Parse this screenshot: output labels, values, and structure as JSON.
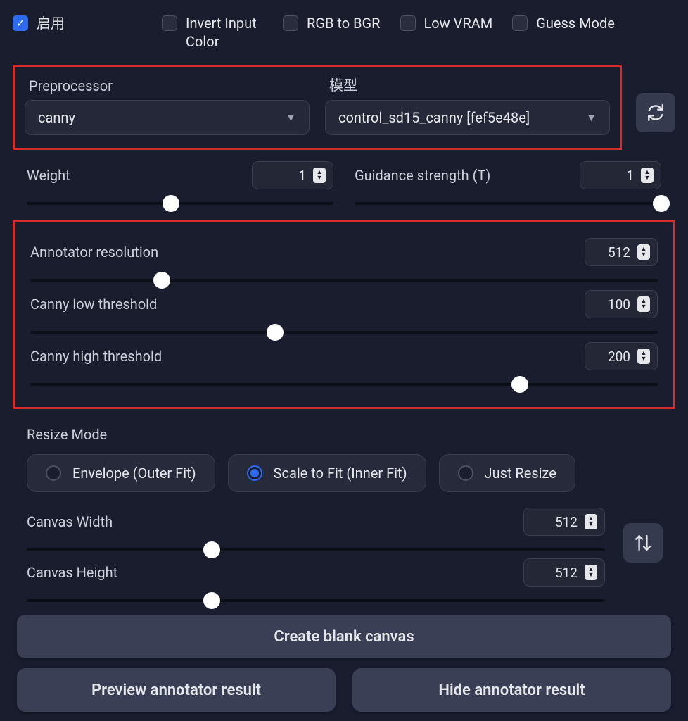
{
  "checkboxes": {
    "enable": {
      "label": "启用",
      "checked": true
    },
    "invert": {
      "label": "Invert Input Color",
      "checked": false
    },
    "rgb_bgr": {
      "label": "RGB to BGR",
      "checked": false
    },
    "low_vram": {
      "label": "Low VRAM",
      "checked": false
    },
    "guess_mode": {
      "label": "Guess Mode",
      "checked": false
    }
  },
  "preprocessor": {
    "label": "Preprocessor",
    "value": "canny"
  },
  "model": {
    "label": "模型",
    "value": "control_sd15_canny [fef5e48e]"
  },
  "weight": {
    "label": "Weight",
    "value": "1",
    "slider_pct": 47
  },
  "guidance": {
    "label": "Guidance strength (T)",
    "value": "1",
    "slider_pct": 100
  },
  "annotator_res": {
    "label": "Annotator resolution",
    "value": "512",
    "slider_pct": 21
  },
  "canny_low": {
    "label": "Canny low threshold",
    "value": "100",
    "slider_pct": 39
  },
  "canny_high": {
    "label": "Canny high threshold",
    "value": "200",
    "slider_pct": 78
  },
  "resize_mode": {
    "title": "Resize Mode",
    "envelope": "Envelope (Outer Fit)",
    "scale_fit": "Scale to Fit (Inner Fit)",
    "just_resize": "Just Resize",
    "selected": "scale_fit"
  },
  "canvas_width": {
    "label": "Canvas Width",
    "value": "512",
    "slider_pct": 32
  },
  "canvas_height": {
    "label": "Canvas Height",
    "value": "512",
    "slider_pct": 32
  },
  "buttons": {
    "create_canvas": "Create blank canvas",
    "preview": "Preview annotator result",
    "hide": "Hide annotator result"
  }
}
